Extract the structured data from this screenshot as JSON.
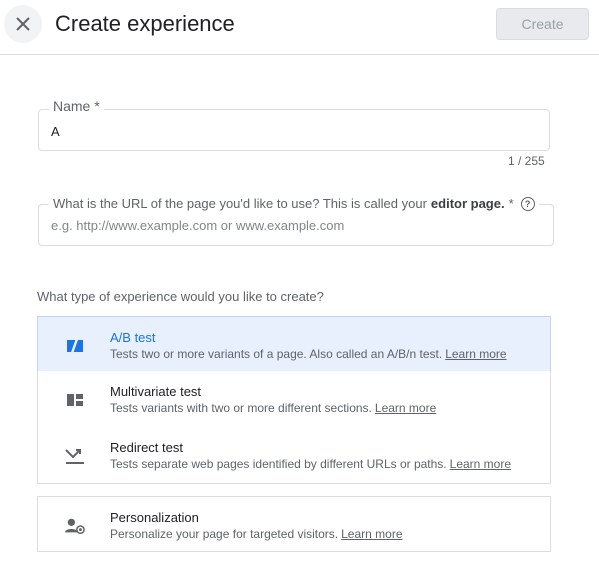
{
  "header": {
    "close_icon": "close-icon",
    "title": "Create experience",
    "create_label": "Create"
  },
  "name_field": {
    "label": "Name *",
    "value": "A",
    "counter": "1 / 255"
  },
  "url_field": {
    "label_prefix": "What is the URL of the page you'd like to use? This is called your",
    "label_bold": "editor page.",
    "label_suffix": "*",
    "help_icon": "help-circle-icon",
    "placeholder": "e.g. http://www.example.com or www.example.com"
  },
  "question": "What type of experience would you like to create?",
  "options": [
    {
      "title": "A/B test",
      "desc": "Tests two or more variants of a page. Also called an A/B/n test.",
      "link": "Learn more",
      "icon": "ab-test-icon",
      "selected": true
    },
    {
      "title": "Multivariate test",
      "desc": "Tests variants with two or more different sections.",
      "link": "Learn more",
      "icon": "multivariate-icon",
      "selected": false
    },
    {
      "title": "Redirect test",
      "desc": "Tests separate web pages identified by different URLs or paths.",
      "link": "Learn more",
      "icon": "redirect-icon",
      "selected": false
    },
    {
      "title": "Personalization",
      "desc": "Personalize your page for targeted visitors.",
      "link": "Learn more",
      "icon": "personalization-icon",
      "selected": false
    }
  ],
  "colors": {
    "accent": "#1a73e8",
    "selected_bg": "#e8f0fe",
    "border": "#dadce0"
  }
}
